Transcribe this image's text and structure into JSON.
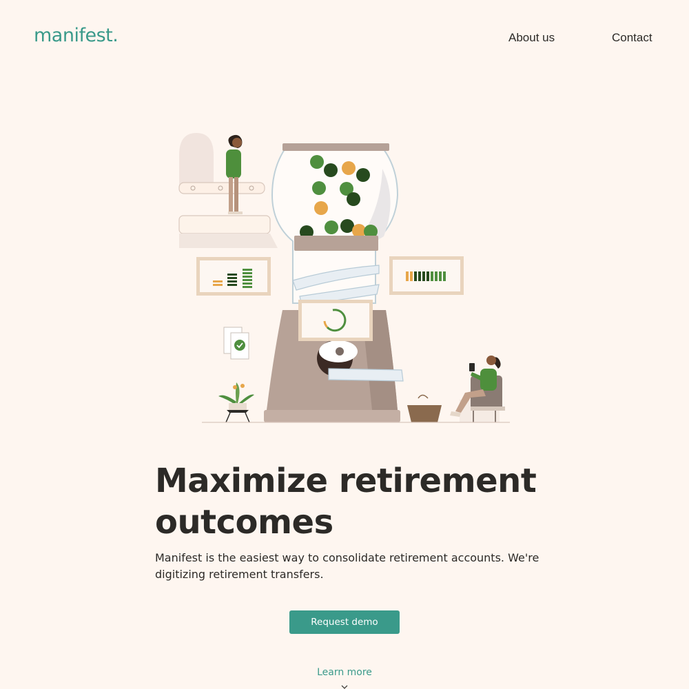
{
  "header": {
    "logo": "manifest.",
    "nav": [
      {
        "label": "About us"
      },
      {
        "label": "Contact"
      }
    ]
  },
  "hero": {
    "title": "Maximize retirement outcomes",
    "subtitle": "Manifest is the easiest way to consolidate retirement accounts. We're digitizing retirement transfers.",
    "cta_label": "Request demo",
    "learn_more_label": "Learn more"
  },
  "colors": {
    "background": "#fef6f0",
    "brand_teal": "#3a9a8a",
    "text": "#2c2a27",
    "machine_base": "#b7a297",
    "green": "#4f8f3f",
    "dark_green": "#274a1e",
    "orange": "#e7a64a"
  },
  "icons": [
    "chevron-down-icon",
    "check-icon"
  ]
}
